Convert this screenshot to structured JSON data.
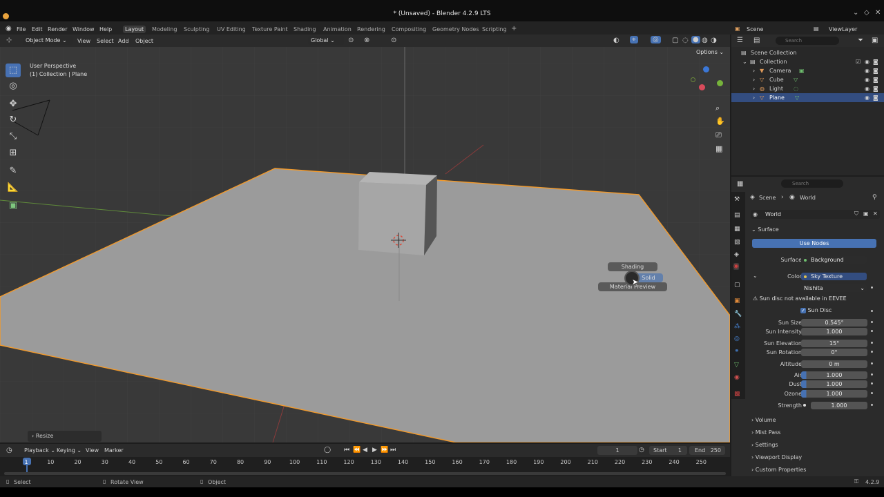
{
  "window": {
    "title": "* (Unsaved) - Blender 4.2.9 LTS"
  },
  "menu": [
    "File",
    "Edit",
    "Render",
    "Window",
    "Help"
  ],
  "workspaces": [
    "Layout",
    "Modeling",
    "Sculpting",
    "UV Editing",
    "Texture Paint",
    "Shading",
    "Animation",
    "Rendering",
    "Compositing",
    "Geometry Nodes",
    "Scripting",
    "+"
  ],
  "scene": {
    "label": "Scene",
    "view_layer": "ViewLayer"
  },
  "viewport_header": {
    "mode": "Object Mode",
    "view": "View",
    "select": "Select",
    "add": "Add",
    "object": "Object",
    "orientation": "Global",
    "options": "Options"
  },
  "viewport": {
    "perspective": "User Perspective",
    "collection_info": "(1) Collection | Plane",
    "resize_panel": "Resize"
  },
  "pie_menu": {
    "top": "Shading",
    "bottom": "Material Preview",
    "right": "Solid"
  },
  "outliner": {
    "search_placeholder": "Search",
    "root": "Scene Collection",
    "collection": "Collection",
    "items": [
      "Camera",
      "Cube",
      "Light",
      "Plane"
    ]
  },
  "properties": {
    "search_placeholder": "Search",
    "breadcrumb_scene": "Scene",
    "breadcrumb_world": "World",
    "world_name": "World",
    "surface_section": "Surface",
    "use_nodes": "Use Nodes",
    "surface_label": "Surface",
    "surface_value": "Background",
    "color_label": "Color",
    "color_value": "Sky Texture",
    "sky_type": "Nishita",
    "warning": "Sun disc not available in EEVEE",
    "sun_disc": "Sun Disc",
    "fields": [
      {
        "label": "Sun Size",
        "value": "0.545°"
      },
      {
        "label": "Sun Intensity",
        "value": "1.000"
      },
      {
        "label": "Sun Elevation",
        "value": "15°"
      },
      {
        "label": "Sun Rotation",
        "value": "0°"
      },
      {
        "label": "Altitude",
        "value": "0 m"
      },
      {
        "label": "Air",
        "value": "1.000"
      },
      {
        "label": "Dust",
        "value": "1.000"
      },
      {
        "label": "Ozone",
        "value": "1.000"
      },
      {
        "label": "Strength",
        "value": "1.000"
      }
    ],
    "sections": [
      "Volume",
      "Mist Pass",
      "Settings",
      "Viewport Display",
      "Custom Properties"
    ]
  },
  "timeline": {
    "playback": "Playback",
    "keying": "Keying",
    "view": "View",
    "marker": "Marker",
    "current_frame": "1",
    "start_label": "Start",
    "start": "1",
    "end_label": "End",
    "end": "250",
    "ticks": [
      "1",
      "10",
      "20",
      "30",
      "40",
      "50",
      "60",
      "70",
      "80",
      "90",
      "100",
      "110",
      "120",
      "130",
      "140",
      "150",
      "160",
      "170",
      "180",
      "190",
      "200",
      "210",
      "220",
      "230",
      "240",
      "250"
    ]
  },
  "statusbar": {
    "select": "Select",
    "rotate": "Rotate View",
    "object": "Object",
    "version": "4.2.9"
  },
  "colors": {
    "accent": "#4772b3",
    "selection_orange": "#f09a2e",
    "viewport_bg": "#393939"
  }
}
